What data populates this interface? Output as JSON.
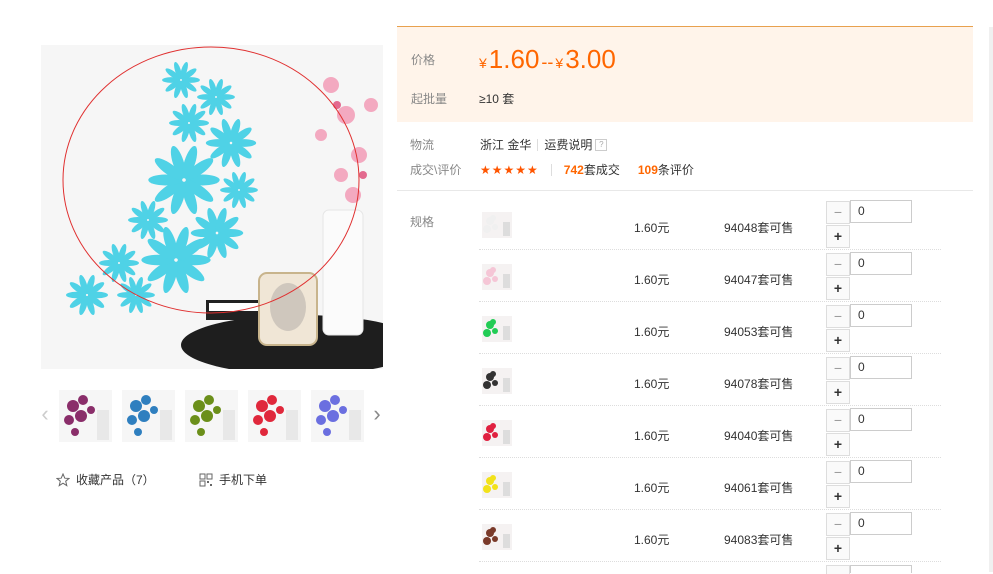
{
  "gallery": {
    "main_image_alt": "",
    "thumbnails": [
      {
        "color": "#8a2e6a"
      },
      {
        "color": "#2f7fbf"
      },
      {
        "color": "#6b8f1a"
      },
      {
        "color": "#e0283c"
      },
      {
        "color": "#6b6fe0"
      }
    ],
    "arrow_left": "‹",
    "arrow_right": "›"
  },
  "actions": {
    "favorite_label": "收藏产品（7）",
    "mobile_order_label": "手机下单"
  },
  "price_panel": {
    "price_label": "价格",
    "currency": "¥",
    "price_min": "1.60",
    "range_sep": "--",
    "price_max": "3.00",
    "moq_label": "起批量",
    "moq_value": "≥10 套"
  },
  "info": {
    "logistics_label": "物流",
    "logistics_location": "浙江 金华",
    "shipping_link": "运费说明",
    "help_icon_text": "?",
    "trade_label": "成交\\评价",
    "stars": "★★★★★",
    "deals_count": "742",
    "deals_unit": "套成交",
    "reviews_count": "109",
    "reviews_unit": "条评价"
  },
  "spec": {
    "label": "规格",
    "rows": [
      {
        "price": "1.60元",
        "stock": "94048套可售",
        "qty": "0",
        "color": "#f0f0f0"
      },
      {
        "price": "1.60元",
        "stock": "94047套可售",
        "qty": "0",
        "color": "#f5c6d6"
      },
      {
        "price": "1.60元",
        "stock": "94053套可售",
        "qty": "0",
        "color": "#22cc55"
      },
      {
        "price": "1.60元",
        "stock": "94078套可售",
        "qty": "0",
        "color": "#333333"
      },
      {
        "price": "1.60元",
        "stock": "94040套可售",
        "qty": "0",
        "color": "#e02040"
      },
      {
        "price": "1.60元",
        "stock": "94061套可售",
        "qty": "0",
        "color": "#f2e21a"
      },
      {
        "price": "1.60元",
        "stock": "94083套可售",
        "qty": "0",
        "color": "#7a3a2a"
      }
    ],
    "minus": "−",
    "plus": "+"
  },
  "colors": {
    "accent": "#ff6600",
    "panel_bg": "#fff4ea",
    "main_flower": "#4fd2e6"
  }
}
